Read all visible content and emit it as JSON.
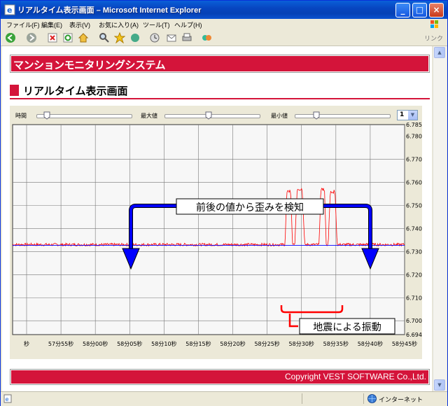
{
  "window": {
    "title": "リアルタイム表示画面 – Microsoft Internet Explorer"
  },
  "menu": [
    "ファイル(F)",
    "編集(E)",
    "表示(V)",
    "お気に入り(A)",
    "ツール(T)",
    "ヘルプ(H)"
  ],
  "toolbar": {
    "links_label": "リンク"
  },
  "page": {
    "banner": "マンションモニタリングシステム",
    "heading": "リアルタイム表示画面",
    "footer": "Copyright VEST SOFTWARE Co.,Ltd."
  },
  "controls": {
    "time_label": "時間",
    "max_label": "最大値",
    "min_label": "最小値",
    "time_value": 0.07,
    "max_value": 0.45,
    "min_value": 0.2,
    "scale_value": "1"
  },
  "chart_data": {
    "type": "line",
    "x_tick_labels": [
      "秒",
      "57分55秒",
      "58分00秒",
      "58分05秒",
      "58分10秒",
      "58分15秒",
      "58分20秒",
      "58分25秒",
      "58分30秒",
      "58分35秒",
      "58分40秒",
      "58分45秒"
    ],
    "y_tick_labels": [
      "6.785",
      "6.780",
      "6.770",
      "6.760",
      "6.750",
      "6.740",
      "6.730",
      "6.720",
      "6.710",
      "6.700",
      "6.694"
    ],
    "y_tick_values": [
      6.785,
      6.78,
      6.77,
      6.76,
      6.75,
      6.74,
      6.73,
      6.72,
      6.71,
      6.7,
      6.694
    ],
    "ylim": [
      6.694,
      6.785
    ],
    "grid": true,
    "series": [
      {
        "color": "#FF0000",
        "baseline": 6.733,
        "peaks": [
          {
            "start": 0.695,
            "end": 0.714,
            "value": 6.756
          },
          {
            "start": 0.72,
            "end": 0.745,
            "value": 6.757
          },
          {
            "start": 0.782,
            "end": 0.8,
            "value": 6.757
          },
          {
            "start": 0.805,
            "end": 0.828,
            "value": 6.756
          }
        ]
      },
      {
        "color": "#0000FF",
        "baseline": 6.733
      }
    ],
    "annotations": [
      {
        "text": "前後の値から歪みを検知",
        "arrow_color": "#0000FF"
      },
      {
        "text": "地震による振動",
        "bracket_color": "#FF0000"
      }
    ]
  },
  "status": {
    "zone": "インターネット"
  },
  "colors": {
    "accent": "#D4143A",
    "panel": "#ECE9D8"
  }
}
